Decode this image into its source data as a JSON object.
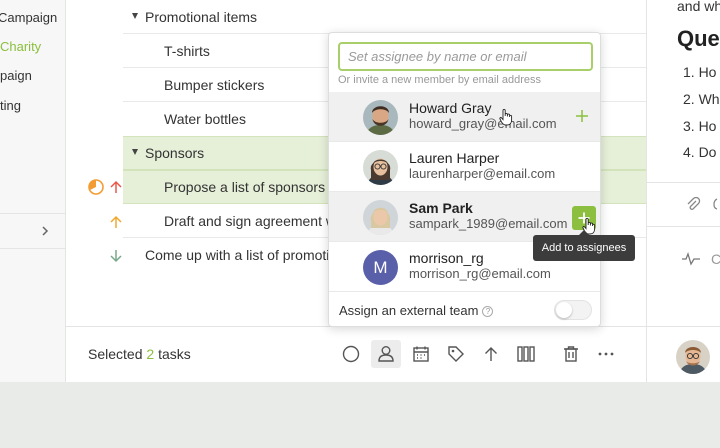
{
  "sidebar": {
    "items": [
      {
        "label": "Campaign"
      },
      {
        "label": "Charity"
      },
      {
        "label": "paign"
      },
      {
        "label": "ting"
      }
    ]
  },
  "tasks": [
    {
      "label": "Promotional items"
    },
    {
      "label": "T-shirts"
    },
    {
      "label": "Bumper stickers"
    },
    {
      "label": "Water bottles"
    },
    {
      "label": "Sponsors"
    },
    {
      "label": "Propose a list of sponsors"
    },
    {
      "label": "Draft and sign agreement w"
    },
    {
      "label": "Come up with a list of promotio"
    }
  ],
  "bottombar": {
    "selected_prefix": "Selected",
    "selected_count": "2",
    "selected_suffix": "tasks"
  },
  "assignee_popup": {
    "search_placeholder": "Set assignee by name or email",
    "invite_hint": "Or invite a new member by email address",
    "people": [
      {
        "name": "Howard Gray",
        "email": "howard_gray@email.com"
      },
      {
        "name": "Lauren Harper",
        "email": "laurenharper@email.com"
      },
      {
        "name": "Sam Park",
        "email": "sampark_1989@email.com"
      },
      {
        "name": "morrison_rg",
        "email": "morrison_rg@email.com",
        "initial": "M"
      }
    ],
    "external_team_label": "Assign an external team",
    "help_glyph": "?",
    "tooltip": "Add to assignees"
  },
  "right_panel": {
    "top_text": "and wh",
    "heading": "Que",
    "items": [
      "1. Ho",
      "2. Wh",
      "3. Ho",
      "4. Do"
    ],
    "activity_letter": "C"
  },
  "colors": {
    "accent": "#8cbf3f",
    "highlight_row": "#e6efd8",
    "priority_high": "#e8584a",
    "priority_medium": "#f0a830",
    "priority_low": "#7aa88a",
    "in_progress": "#f39c33",
    "avatar_m": "#5a5faa"
  },
  "icons": {
    "toolbar": [
      "circle-status-icon",
      "person-assign-icon",
      "calendar-icon",
      "tag-icon",
      "arrow-up-icon",
      "columns-icon",
      "trash-icon",
      "more-icon"
    ]
  }
}
